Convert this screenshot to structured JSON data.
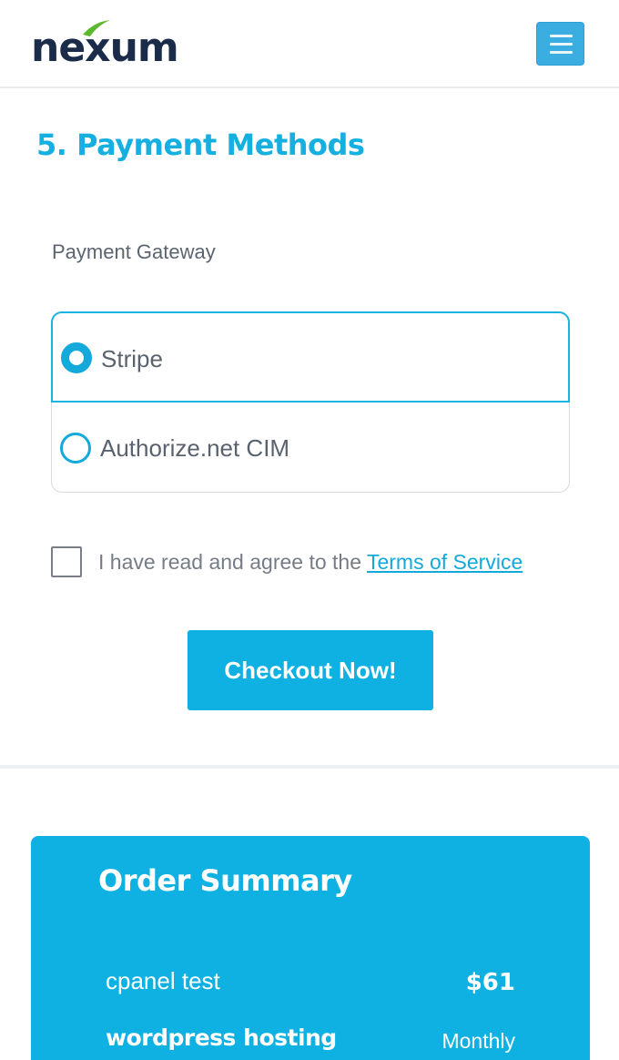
{
  "header": {
    "logo_text_before": "ne",
    "logo_text_x": "x",
    "logo_text_after": "um",
    "menu_icon": "hamburger-menu-icon"
  },
  "payment": {
    "section_title": "5. Payment Methods",
    "gateway_label": "Payment Gateway",
    "options": [
      {
        "label": "Stripe",
        "selected": true
      },
      {
        "label": "Authorize.net CIM",
        "selected": false
      }
    ],
    "tos_text": "I have read and agree to the ",
    "tos_link": "Terms of Service",
    "tos_checked": false,
    "checkout_label": "Checkout Now!"
  },
  "summary": {
    "title": "Order Summary",
    "items": [
      {
        "name": "cpanel test",
        "price": "$61"
      },
      {
        "name": "wordpress hosting",
        "cycle": "Monthly"
      }
    ]
  },
  "colors": {
    "accent": "#0fb1e2",
    "logo_navy": "#1b2b4a",
    "logo_green": "#5cb82e"
  }
}
